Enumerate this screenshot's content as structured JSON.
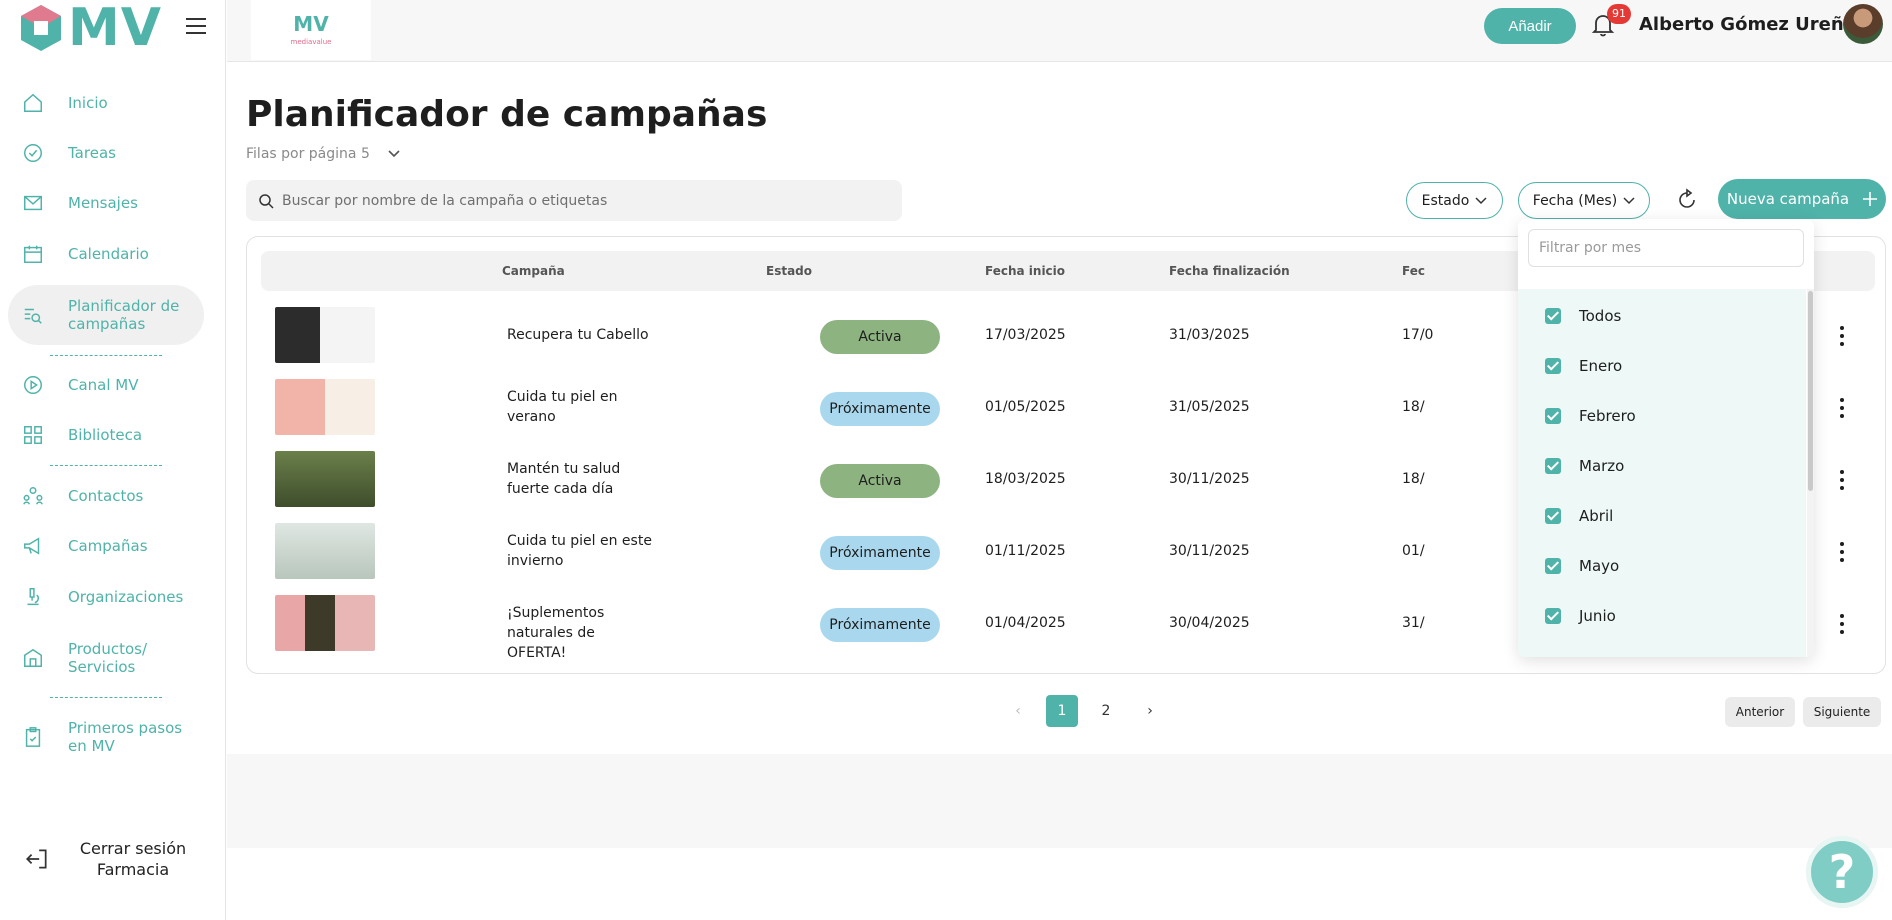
{
  "brand": {
    "name": "MV"
  },
  "topbar": {
    "logo_text": "MV",
    "logo_tagline": "mediavalue",
    "add_label": "Añadir",
    "notifications_count": "91",
    "user_name": "Alberto Gómez Ureña"
  },
  "sidebar": {
    "items": [
      {
        "label": "Inicio",
        "icon": "home-icon"
      },
      {
        "label": "Tareas",
        "icon": "check-circle-icon"
      },
      {
        "label": "Mensajes",
        "icon": "mail-icon"
      },
      {
        "label": "Calendario",
        "icon": "calendar-icon"
      },
      {
        "label": "Planificador de campañas",
        "icon": "list-search-icon"
      },
      {
        "label": "Canal MV",
        "icon": "play-circle-icon"
      },
      {
        "label": "Biblioteca",
        "icon": "grid-icon"
      },
      {
        "label": "Contactos",
        "icon": "people-icon"
      },
      {
        "label": "Campañas",
        "icon": "megaphone-icon"
      },
      {
        "label": "Organizaciones",
        "icon": "microscope-icon"
      },
      {
        "label": "Productos/ Servicios",
        "icon": "store-icon"
      },
      {
        "label": "Primeros pasos en MV",
        "icon": "clipboard-icon"
      }
    ],
    "logout_label": "Cerrar sesión Farmacia"
  },
  "page": {
    "title": "Planificador de campañas",
    "rows_per_page": "Filas por página 5",
    "search_placeholder": "Buscar por nombre de la campaña o etiquetas",
    "filter_estado": "Estado",
    "filter_fecha": "Fecha (Mes)",
    "new_campaign": "Nueva campaña"
  },
  "table": {
    "headers": [
      "Campaña",
      "Estado",
      "Fecha inicio",
      "Fecha finalización",
      "Fec"
    ],
    "rows": [
      {
        "name": "Recupera tu Cabello",
        "status": "Activa",
        "start": "17/03/2025",
        "end": "31/03/2025",
        "extra": "17/0"
      },
      {
        "name": "Cuida tu piel en verano",
        "status": "Próximamente",
        "start": "01/05/2025",
        "end": "31/05/2025",
        "extra": "18/"
      },
      {
        "name": "Mantén tu salud fuerte cada día",
        "status": "Activa",
        "start": "18/03/2025",
        "end": "30/11/2025",
        "extra": "18/"
      },
      {
        "name": "Cuida tu piel en este invierno",
        "status": "Próximamente",
        "start": "01/11/2025",
        "end": "30/11/2025",
        "extra": "01/"
      },
      {
        "name": "¡Suplementos naturales de OFERTA!",
        "status": "Próximamente",
        "start": "01/04/2025",
        "end": "30/04/2025",
        "extra": "31/"
      }
    ]
  },
  "pagination": {
    "pages": [
      "1",
      "2"
    ],
    "current": "1",
    "prev_label": "Anterior",
    "next_label": "Siguiente"
  },
  "dropdown": {
    "placeholder": "Filtrar por mes",
    "options": [
      "Todos",
      "Enero",
      "Febrero",
      "Marzo",
      "Abril",
      "Mayo",
      "Junio"
    ]
  },
  "help": {
    "label": "?"
  },
  "colors": {
    "accent": "#4fb3a9",
    "activa": "#8db380",
    "proximamente": "#a9d8ee",
    "badge": "#e53935"
  }
}
